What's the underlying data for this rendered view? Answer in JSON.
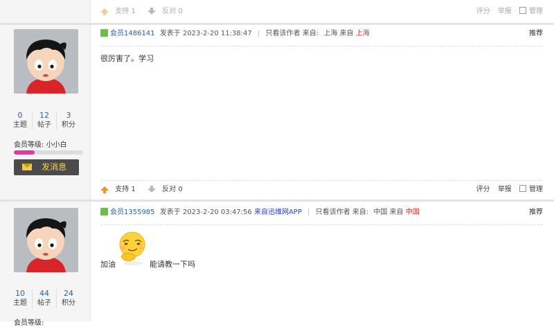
{
  "top_actions": {
    "support": "支持",
    "support_count": "1",
    "oppose": "反对",
    "oppose_count": "0",
    "rate": "评分",
    "report": "举报",
    "manage": "管理"
  },
  "posts": [
    {
      "stats": [
        {
          "num": "0",
          "label": "主题"
        },
        {
          "num": "12",
          "label": "帖子"
        },
        {
          "num": "3",
          "label": "积分"
        }
      ],
      "level_label": "会员等级:",
      "level_name": "小小白",
      "level_progress": 0.3,
      "message_button": "发消息",
      "username": "会员1486141",
      "posted_prefix": "发表于",
      "posted_time": "2023-2-20 11:38:47",
      "only_author": "只看该作者",
      "from_label": "来自:",
      "location": "上海",
      "from_label2": "来自",
      "location_red": "上海",
      "recommend": "推荐",
      "body": "很厉害了。学习",
      "actions": {
        "support": "支持",
        "support_count": "1",
        "oppose": "反对",
        "oppose_count": "0",
        "rate": "评分",
        "report": "举报",
        "manage": "管理"
      }
    },
    {
      "stats": [
        {
          "num": "10",
          "label": "主题"
        },
        {
          "num": "44",
          "label": "帖子"
        },
        {
          "num": "24",
          "label": "积分"
        }
      ],
      "level_label": "会员等级:",
      "username": "会员1355985",
      "posted_prefix": "发表于",
      "posted_time": "2023-2-20 03:47:56",
      "source": "来自迅维网APP",
      "only_author": "只看该作者",
      "from_label": "来自:",
      "location": "中国",
      "from_label2": "来自",
      "location_red": "中国",
      "recommend": "推荐",
      "body_before": "加油",
      "body_after": "能请教一下吗"
    }
  ]
}
